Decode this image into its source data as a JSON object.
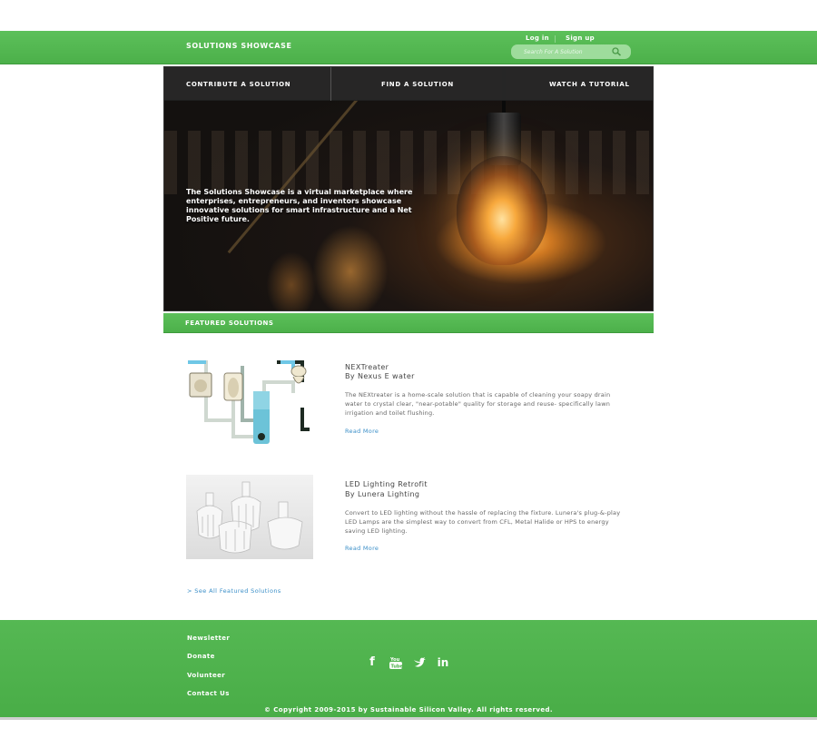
{
  "header": {
    "site_title": "SOLUTIONS SHOWCASE",
    "login_label": "Log in",
    "signup_label": "Sign up",
    "search_placeholder": "Search For A Solution"
  },
  "hero": {
    "nav": [
      "CONTRIBUTE A SOLUTION",
      "FIND A SOLUTION",
      "WATCH A TUTORIAL"
    ],
    "tagline": "The Solutions Showcase is a virtual marketplace where enterprises, entrepreneurs, and inventors showcase innovative solutions for smart infrastructure and a Net Positive future."
  },
  "featured": {
    "heading": "FEATURED SOLUTIONS",
    "items": [
      {
        "name": "NEXTreater",
        "by": "By Nexus E water",
        "description": "The NEXtreater is a home-scale solution that is capable of cleaning your soapy drain water to crystal clear, \"near-potable\" quality for storage and reuse- specifically lawn irrigation and toilet flushing.",
        "read_more": "Read More"
      },
      {
        "name": "LED Lighting Retrofit",
        "by": "By Lunera Lighting",
        "description": "Convert to LED lighting without the hassle of replacing the fixture. Lunera's plug-&-play LED Lamps are the simplest way to convert from CFL, Metal Halide or HPS to energy saving LED lighting.",
        "read_more": "Read More"
      }
    ],
    "see_all": "> See All Featured Solutions"
  },
  "footer": {
    "links": [
      "Newsletter",
      "Donate",
      "Volunteer",
      "Contact Us"
    ],
    "social_icons": [
      "facebook-icon",
      "youtube-icon",
      "twitter-icon",
      "linkedin-icon"
    ],
    "copyright": "© Copyright 2009-2015 by Sustainable Silicon Valley. All rights reserved."
  },
  "colors": {
    "brand_green": "#4cb04a",
    "link_blue": "#3b8fc8",
    "nav_dark": "#282828"
  }
}
